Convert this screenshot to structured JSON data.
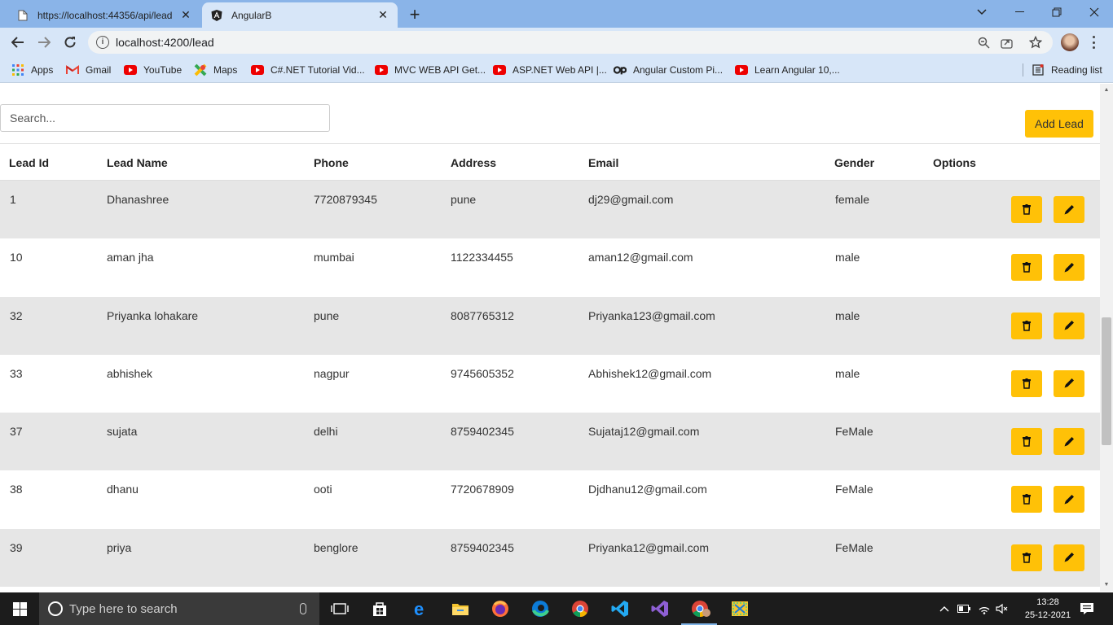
{
  "browser": {
    "tabs": [
      {
        "title": "https://localhost:44356/api/lead",
        "active": false
      },
      {
        "title": "AngularB",
        "active": true
      }
    ],
    "address": "localhost:4200/lead",
    "bookmarks": [
      {
        "label": "Apps",
        "icon": "apps-grid-icon"
      },
      {
        "label": "Gmail",
        "icon": "gmail-icon"
      },
      {
        "label": "YouTube",
        "icon": "youtube-icon"
      },
      {
        "label": "Maps",
        "icon": "maps-icon"
      },
      {
        "label": "C#.NET Tutorial Vid...",
        "icon": "youtube-icon"
      },
      {
        "label": "MVC WEB API Get...",
        "icon": "youtube-icon"
      },
      {
        "label": "ASP.NET Web API |...",
        "icon": "youtube-icon"
      },
      {
        "label": "Angular Custom Pi...",
        "icon": "codeproject-icon"
      },
      {
        "label": "Learn Angular 10,...",
        "icon": "youtube-icon"
      }
    ],
    "reading_list": "Reading list"
  },
  "page": {
    "search_placeholder": "Search...",
    "add_button": "Add Lead",
    "columns": [
      "Lead Id",
      "Lead Name",
      "Phone",
      "Address",
      "Email",
      "Gender",
      "Options"
    ],
    "rows": [
      {
        "id": "1",
        "name": "Dhanashree",
        "phone": "7720879345",
        "address": "pune",
        "email": "dj29@gmail.com",
        "gender": "female"
      },
      {
        "id": "10",
        "name": "aman jha",
        "phone": "mumbai",
        "address": "1122334455",
        "email": "aman12@gmail.com",
        "gender": "male"
      },
      {
        "id": "32",
        "name": "Priyanka lohakare",
        "phone": "pune",
        "address": "8087765312",
        "email": "Priyanka123@gmail.com",
        "gender": "male"
      },
      {
        "id": "33",
        "name": "abhishek",
        "phone": "nagpur",
        "address": "9745605352",
        "email": "Abhishek12@gmail.com",
        "gender": "male"
      },
      {
        "id": "37",
        "name": "sujata",
        "phone": "delhi",
        "address": "8759402345",
        "email": "Sujataj12@gmail.com",
        "gender": "FeMale"
      },
      {
        "id": "38",
        "name": "dhanu",
        "phone": "ooti",
        "address": "7720678909",
        "email": "Djdhanu12@gmail.com",
        "gender": "FeMale"
      },
      {
        "id": "39",
        "name": "priya",
        "phone": "benglore",
        "address": "8759402345",
        "email": "Priyanka12@gmail.com",
        "gender": "FeMale"
      }
    ],
    "accent_color": "#ffc107"
  },
  "taskbar": {
    "search_placeholder": "Type here to search",
    "time": "13:28",
    "date": "25-12-2021"
  }
}
